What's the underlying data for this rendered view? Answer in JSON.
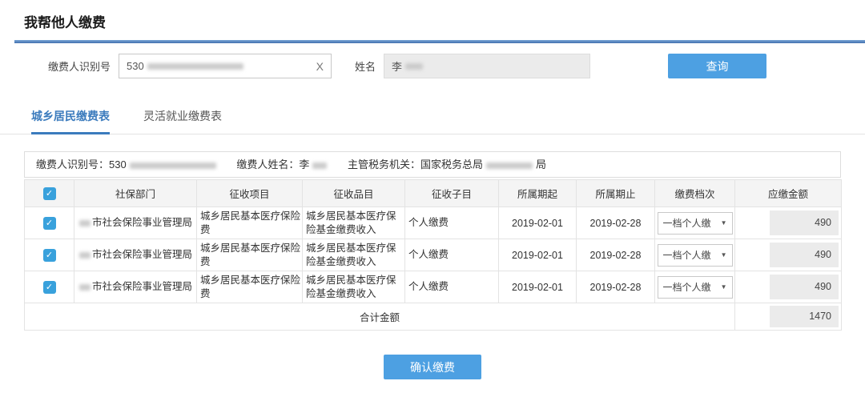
{
  "page": {
    "title": "我帮他人缴费"
  },
  "icons": {
    "clear": "X",
    "check": "✓",
    "caret_down": "▼"
  },
  "colors": {
    "accent_blue": "#4da0e2",
    "divider_blue": "#416fae",
    "tab_active_blue": "#3b7bbd",
    "checkbox_blue": "#39a1dc"
  },
  "search": {
    "taxpayer_id_label": "缴费人识别号",
    "taxpayer_id_value_visible": "530",
    "name_label": "姓名",
    "name_value_visible": "李",
    "query_button_label": "查询"
  },
  "tabs": [
    {
      "label": "城乡居民缴费表",
      "active": true
    },
    {
      "label": "灵活就业缴费表",
      "active": false
    }
  ],
  "info_bar": {
    "id_label": "缴费人识别号：",
    "id_value_visible": "530",
    "name_label": "缴费人姓名：",
    "name_value_visible": "李",
    "authority_label": "主管税务机关：",
    "authority_prefix": "国家税务总局",
    "authority_suffix": "局"
  },
  "table": {
    "headers": [
      "社保部门",
      "征收项目",
      "征收品目",
      "征收子目",
      "所属期起",
      "所属期止",
      "缴费档次",
      "应缴金额"
    ],
    "rows": [
      {
        "checked": true,
        "department_visible": "市社会保险事业管理局",
        "levy_item": "城乡居民基本医疗保险费",
        "levy_category": "城乡居民基本医疗保险基金缴费收入",
        "levy_sub_item": "个人缴费",
        "period_start": "2019-02-01",
        "period_end": "2019-02-28",
        "tier": "一档个人缴",
        "amount": "490"
      },
      {
        "checked": true,
        "department_visible": "市社会保险事业管理局",
        "levy_item": "城乡居民基本医疗保险费",
        "levy_category": "城乡居民基本医疗保险基金缴费收入",
        "levy_sub_item": "个人缴费",
        "period_start": "2019-02-01",
        "period_end": "2019-02-28",
        "tier": "一档个人缴",
        "amount": "490"
      },
      {
        "checked": true,
        "department_visible": "市社会保险事业管理局",
        "levy_item": "城乡居民基本医疗保险费",
        "levy_category": "城乡居民基本医疗保险基金缴费收入",
        "levy_sub_item": "个人缴费",
        "period_start": "2019-02-01",
        "period_end": "2019-02-28",
        "tier": "一档个人缴",
        "amount": "490"
      }
    ],
    "footer": {
      "total_label": "合计金额",
      "total_amount": "1470"
    }
  },
  "confirm": {
    "label": "确认缴费"
  }
}
